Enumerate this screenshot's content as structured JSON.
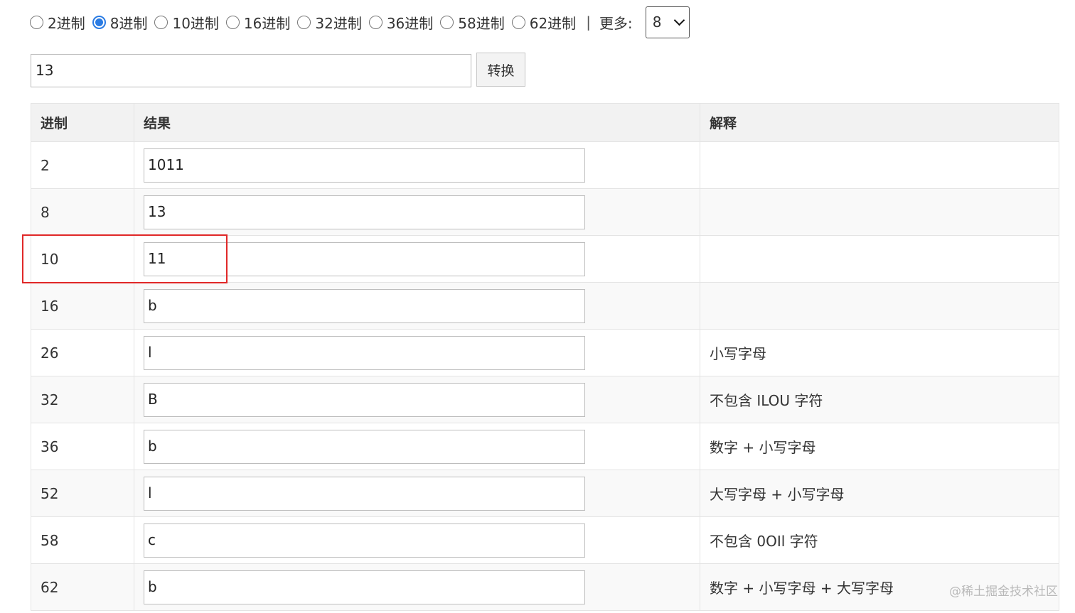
{
  "base_options": [
    {
      "label": "2进制",
      "checked": false
    },
    {
      "label": "8进制",
      "checked": true
    },
    {
      "label": "10进制",
      "checked": false
    },
    {
      "label": "16进制",
      "checked": false
    },
    {
      "label": "32进制",
      "checked": false
    },
    {
      "label": "36进制",
      "checked": false
    },
    {
      "label": "58进制",
      "checked": false
    },
    {
      "label": "62进制",
      "checked": false
    }
  ],
  "separator": "|",
  "more_label": "更多:",
  "more_select_value": "8",
  "input_value": "13",
  "convert_label": "转换",
  "table": {
    "headers": [
      "进制",
      "结果",
      "解释"
    ],
    "rows": [
      {
        "base": "2",
        "result": "1011",
        "note": ""
      },
      {
        "base": "8",
        "result": "13",
        "note": ""
      },
      {
        "base": "10",
        "result": "11",
        "note": ""
      },
      {
        "base": "16",
        "result": "b",
        "note": ""
      },
      {
        "base": "26",
        "result": "l",
        "note": "小写字母"
      },
      {
        "base": "32",
        "result": "B",
        "note": "不包含 ILOU 字符"
      },
      {
        "base": "36",
        "result": "b",
        "note": "数字 + 小写字母"
      },
      {
        "base": "52",
        "result": "l",
        "note": "大写字母 + 小写字母"
      },
      {
        "base": "58",
        "result": "c",
        "note": "不包含 0OIl 字符"
      },
      {
        "base": "62",
        "result": "b",
        "note": "数字 + 小写字母 + 大写字母"
      }
    ]
  },
  "watermark": "@稀土掘金技术社区",
  "colors": {
    "accent": "#2a7be3",
    "highlight": "#e02828"
  }
}
